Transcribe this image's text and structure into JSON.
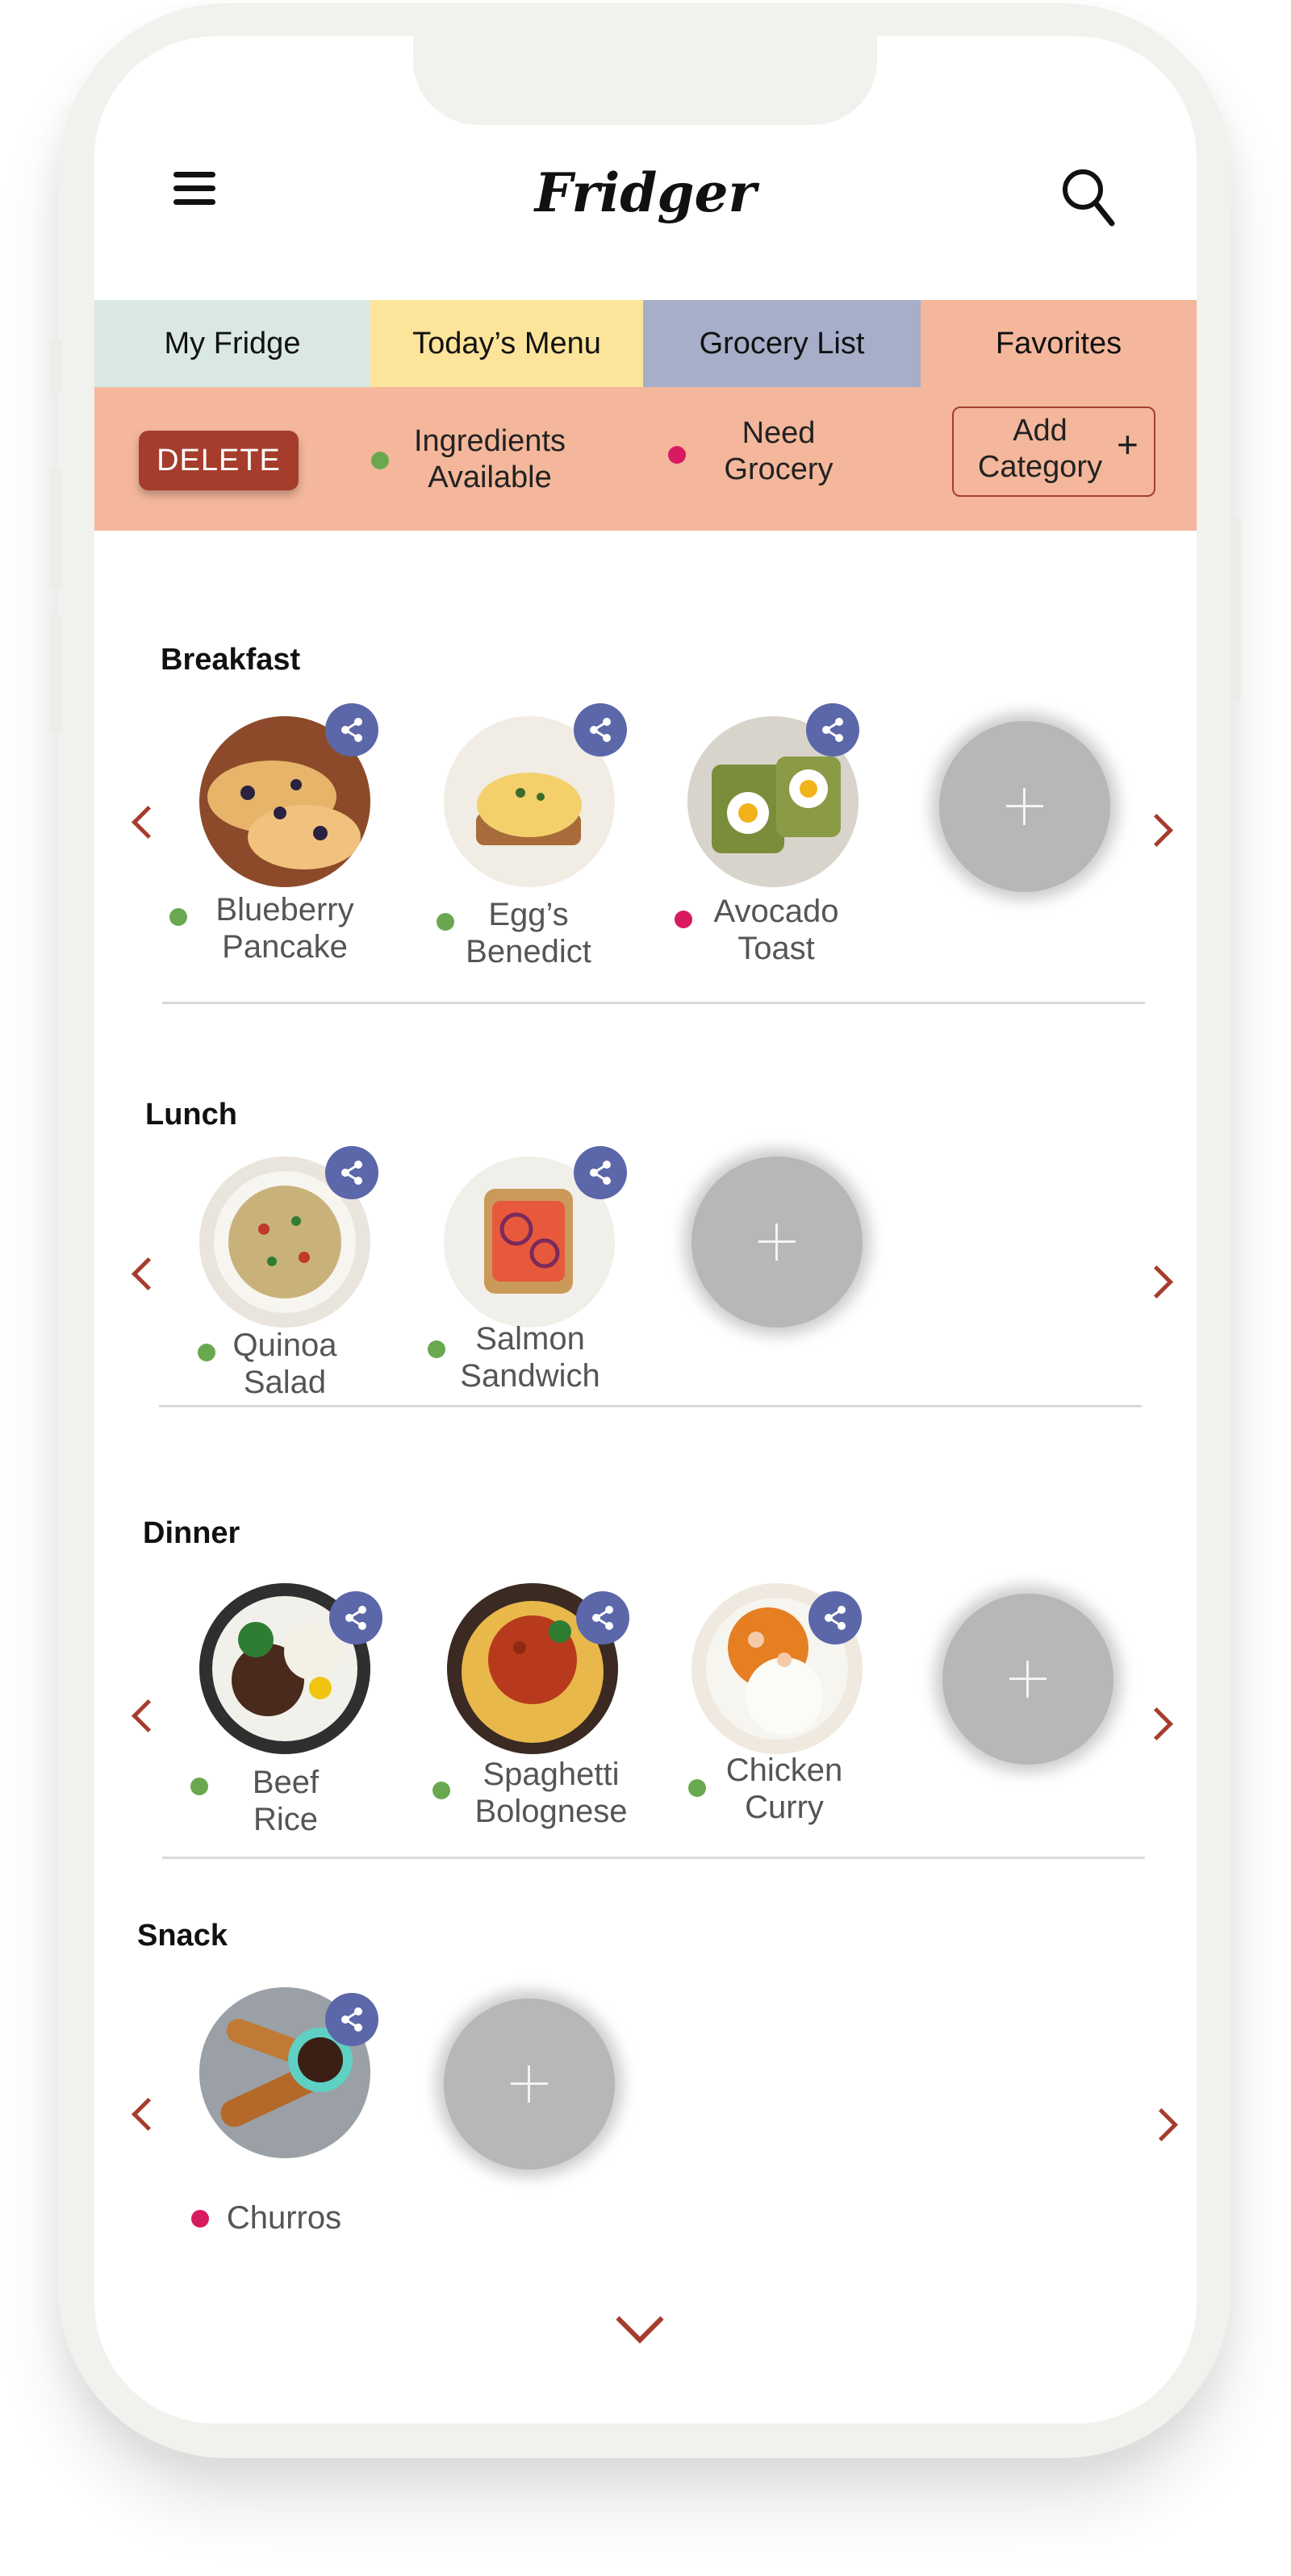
{
  "app": {
    "title": "Fridger"
  },
  "tabs": [
    {
      "label": "My Fridge"
    },
    {
      "label": "Today’s Menu"
    },
    {
      "label": "Grocery List"
    },
    {
      "label": "Favorites"
    }
  ],
  "toolbar": {
    "delete_label": "DELETE",
    "legend_available": "Ingredients Available",
    "legend_need": "Need Grocery",
    "add_category": "Add Category"
  },
  "colors": {
    "available": "#6aa84f",
    "need": "#d81b60",
    "accent": "#a63d2c",
    "share": "#5b67a8"
  },
  "sections": [
    {
      "title": "Breakfast",
      "dishes": [
        {
          "name": "Blueberry Pancake",
          "status": "available"
        },
        {
          "name": "Egg’s Benedict",
          "status": "available"
        },
        {
          "name": "Avocado Toast",
          "status": "need"
        }
      ]
    },
    {
      "title": "Lunch",
      "dishes": [
        {
          "name": "Quinoa Salad",
          "status": "available"
        },
        {
          "name": "Salmon Sandwich",
          "status": "available"
        }
      ]
    },
    {
      "title": "Dinner",
      "dishes": [
        {
          "name": "Beef Rice",
          "status": "available"
        },
        {
          "name": "Spaghetti Bolognese",
          "status": "available"
        },
        {
          "name": "Chicken Curry",
          "status": "available"
        }
      ]
    },
    {
      "title": "Snack",
      "dishes": [
        {
          "name": "Churros",
          "status": "need"
        }
      ]
    }
  ],
  "icons": {
    "menu": "menu-icon",
    "search": "search-icon",
    "share": "share-icon",
    "add": "plus-icon",
    "prev": "chevron-left-icon",
    "next": "chevron-right-icon",
    "more": "chevron-down-icon"
  }
}
